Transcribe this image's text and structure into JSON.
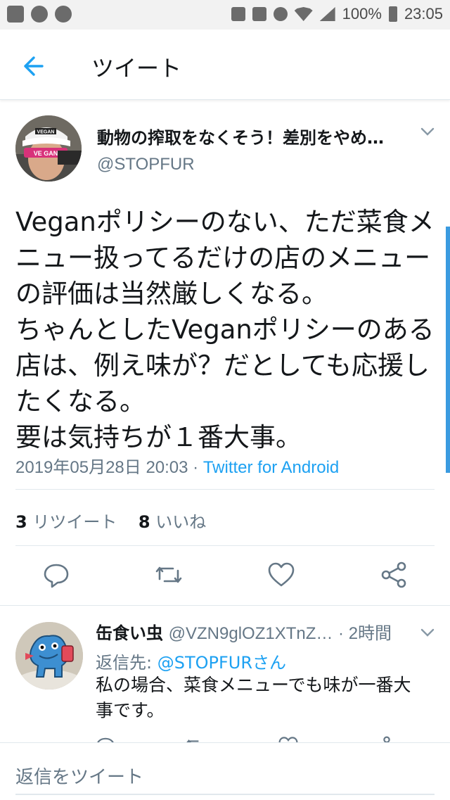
{
  "status_bar": {
    "battery": "100%",
    "time": "23:05"
  },
  "header": {
    "title": "ツイート"
  },
  "tweet": {
    "author_name": "動物の搾取をなくそう！差別をやめ…",
    "author_handle": "@STOPFUR",
    "text": "Veganポリシーのない、ただ菜食メ\nニュー扱ってるだけの店のメニュー\nの評価は当然厳しくなる。\nちゃんとしたVeganポリシーのある\n店は、例え味が？だとしても応援し\nたくなる。\n要は気持ちが１番大事。",
    "timestamp": "2019年05月28日 20:03 · ",
    "source": "Twitter for Android",
    "retweet_count": "3",
    "retweet_label": "リツイート",
    "like_count": "8",
    "like_label": "いいね",
    "avatar_cap_text": "VEGAN",
    "avatar_mask_text": "VE GAN"
  },
  "reply": {
    "author_name": "缶食い虫",
    "author_handle": "@VZN9glOZ1XTnZ…",
    "time": "· 2時間",
    "reply_to_prefix": "返信先: ",
    "reply_to_mention": "@STOPFURさん",
    "text": "私の場合、菜食メニューでも味が一番大\n事です。"
  },
  "compose": {
    "placeholder": "返信をツイート"
  },
  "colors": {
    "accent": "#1da1f2",
    "text": "#14171a",
    "secondary": "#657786",
    "divider": "#e1e8ed"
  }
}
